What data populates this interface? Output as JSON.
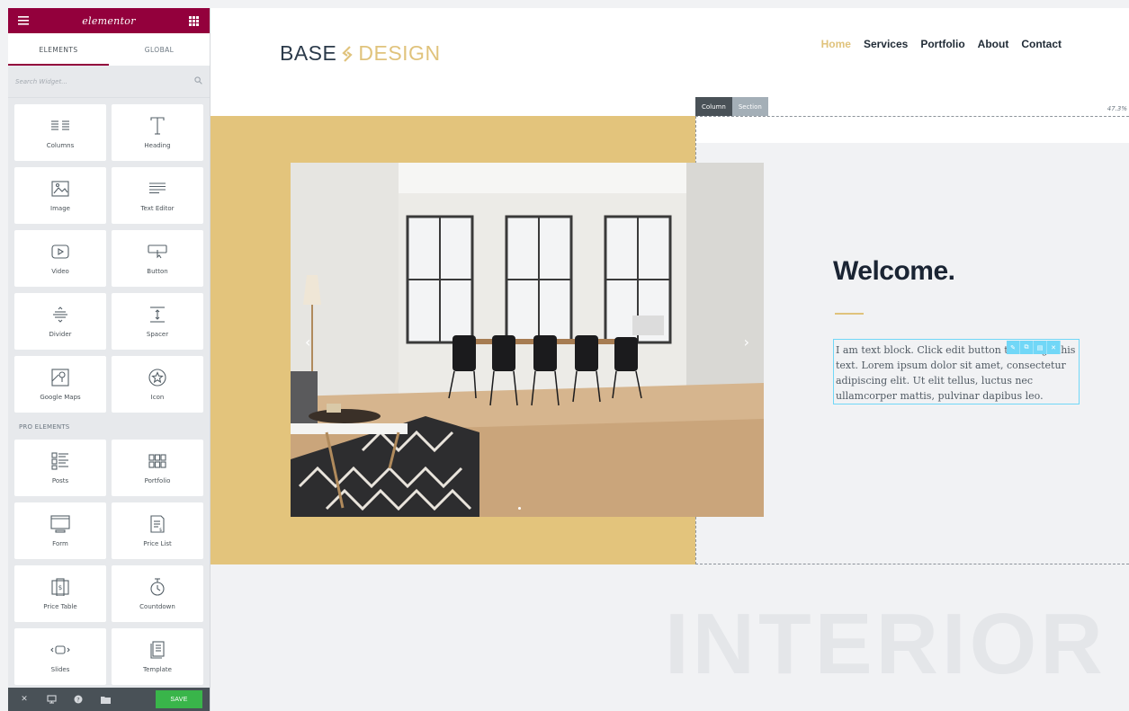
{
  "editor": {
    "brand": "elementor",
    "tabs": [
      {
        "label": "ELEMENTS"
      },
      {
        "label": "GLOBAL"
      }
    ],
    "search_placeholder": "Search Widget...",
    "basic_widgets": [
      {
        "label": "Columns",
        "icon": "columns-icon"
      },
      {
        "label": "Heading",
        "icon": "heading-icon"
      },
      {
        "label": "Image",
        "icon": "image-icon"
      },
      {
        "label": "Text Editor",
        "icon": "text-editor-icon"
      },
      {
        "label": "Video",
        "icon": "video-icon"
      },
      {
        "label": "Button",
        "icon": "button-icon"
      },
      {
        "label": "Divider",
        "icon": "divider-icon"
      },
      {
        "label": "Spacer",
        "icon": "spacer-icon"
      },
      {
        "label": "Google Maps",
        "icon": "google-maps-icon"
      },
      {
        "label": "Icon",
        "icon": "star-icon"
      }
    ],
    "pro_label": "PRO ELEMENTS",
    "pro_widgets": [
      {
        "label": "Posts",
        "icon": "posts-icon"
      },
      {
        "label": "Portfolio",
        "icon": "portfolio-icon"
      },
      {
        "label": "Form",
        "icon": "form-icon"
      },
      {
        "label": "Price List",
        "icon": "price-list-icon"
      },
      {
        "label": "Price Table",
        "icon": "price-table-icon"
      },
      {
        "label": "Countdown",
        "icon": "countdown-icon"
      },
      {
        "label": "Slides",
        "icon": "slides-icon"
      },
      {
        "label": "Template",
        "icon": "template-icon"
      }
    ],
    "footer": {
      "save_label": "SAVE"
    },
    "accent_color": "#93003c",
    "save_color": "#39b54a"
  },
  "site": {
    "logo_part1": "BASE",
    "logo_part2": "DESIGN",
    "nav": [
      "Home",
      "Services",
      "Portfolio",
      "About",
      "Contact"
    ],
    "active_nav": "Home",
    "accent_color": "#e3c47c"
  },
  "section": {
    "handle_column": "Column",
    "handle_section": "Section",
    "width_readout": "47.3%",
    "heading": "Welcome.",
    "text_block": "I am text block. Click edit button to change this text. Lorem ipsum dolor sit amet, consectetur adipiscing elit. Ut elit tellus, luctus nec ullamcorper mattis, pulvinar dapibus leo.",
    "background_word": "INTERIOR"
  }
}
